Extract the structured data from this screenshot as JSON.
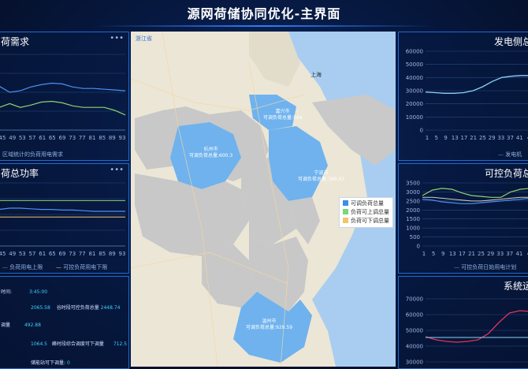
{
  "header": {
    "title": "源网荷储协同优化-主界面"
  },
  "panels": {
    "load_demand": {
      "title": "荷需求",
      "legend": "区域统计的负荷用电需求"
    },
    "load_power": {
      "title": "荷总功率",
      "legend_a": "负荷用电上限",
      "legend_b": "可控负荷用电下限"
    },
    "info": {
      "rows": [
        {
          "label": "时间",
          "value": "3:45:00"
        },
        {
          "label": "",
          "value": "2065.58",
          "label2": "谷时段可控负荷总量",
          "value2": "2448.74"
        },
        {
          "label": "调量",
          "value": "492.88"
        },
        {
          "label": "",
          "value": "1064.5",
          "label2": "峰时段综合调度可下调量",
          "value2": "712.5"
        },
        {
          "label": "储能站可下调量",
          "value": "0"
        }
      ]
    },
    "gen_side": {
      "title": "发电侧总",
      "legend": "发电机"
    },
    "ctrl_load": {
      "title": "可控负荷总",
      "legend": "可控负荷日始用电计划"
    },
    "sys_run": {
      "title": "系统运"
    }
  },
  "map": {
    "province": "浙江省",
    "shanghai": "上海",
    "cities": [
      {
        "name": "嘉兴市",
        "label": "可调负荷总量",
        "value": "564"
      },
      {
        "name": "杭州市",
        "label": "可调负荷总量",
        "value": "600.3"
      },
      {
        "name": "宁波市",
        "label": "可调负荷总量",
        "value": "389.63"
      },
      {
        "name": "温州市",
        "label": "可调负荷总量",
        "value": "929.59"
      }
    ],
    "legend": [
      "可调负荷总量",
      "负荷可上调总量",
      "负荷可下调总量"
    ],
    "legend_colors": [
      "#3b8fe8",
      "#7ad67a",
      "#f2c46b"
    ]
  },
  "axes": {
    "left_x_ticks": [
      "45",
      "49",
      "53",
      "57",
      "61",
      "65",
      "69",
      "73",
      "77",
      "81",
      "85",
      "89",
      "93"
    ],
    "right_x_ticks": [
      "1",
      "5",
      "9",
      "13",
      "17",
      "21",
      "25",
      "29",
      "33",
      "37",
      "41",
      "4"
    ],
    "gen_y": [
      "60000",
      "50000",
      "40000",
      "30000",
      "20000",
      "10000",
      "0"
    ],
    "ctrl_y": [
      "3500",
      "3000",
      "2500",
      "2000",
      "1500",
      "1000",
      "500",
      "0"
    ],
    "sys_y": [
      "70000",
      "60000",
      "50000",
      "40000",
      "30000"
    ]
  },
  "chart_data": [
    {
      "type": "line",
      "title": "荷需求",
      "x": [
        "45",
        "49",
        "53",
        "57",
        "61",
        "65",
        "69",
        "73",
        "77",
        "81",
        "85",
        "89",
        "93"
      ],
      "series": [
        {
          "values": [
            0.58,
            0.5,
            0.52,
            0.57,
            0.6,
            0.62,
            0.61,
            0.57,
            0.55,
            0.55,
            0.54,
            0.53,
            0.52
          ]
        },
        {
          "values": [
            0.3,
            0.35,
            0.3,
            0.33,
            0.37,
            0.38,
            0.36,
            0.32,
            0.3,
            0.3,
            0.3,
            0.26,
            0.2
          ]
        }
      ]
    },
    {
      "type": "line",
      "title": "荷总功率",
      "x": [
        "45",
        "49",
        "53",
        "57",
        "61",
        "65",
        "69",
        "73",
        "77",
        "81",
        "85",
        "89",
        "93"
      ],
      "series": [
        {
          "name": "负荷用电上限",
          "values": [
            0.72,
            0.72,
            0.72,
            0.72,
            0.72,
            0.72,
            0.72,
            0.72,
            0.72,
            0.72,
            0.72,
            0.72,
            0.72
          ]
        },
        {
          "name": "可控负荷用电下限",
          "values": [
            0.46,
            0.46,
            0.46,
            0.46,
            0.46,
            0.46,
            0.46,
            0.46,
            0.46,
            0.46,
            0.46,
            0.46,
            0.46
          ]
        },
        {
          "values": [
            0.58,
            0.6,
            0.6,
            0.59,
            0.58,
            0.58,
            0.57,
            0.57,
            0.56,
            0.55,
            0.55,
            0.55,
            0.55
          ]
        }
      ]
    },
    {
      "type": "line",
      "title": "发电侧总",
      "x": [
        "1",
        "5",
        "9",
        "13",
        "17",
        "21",
        "25",
        "29",
        "33",
        "37",
        "41",
        "4"
      ],
      "ylim": [
        0,
        60000
      ],
      "series": [
        {
          "name": "发电机",
          "values": [
            29000,
            28500,
            28000,
            28000,
            28500,
            30000,
            33000,
            37000,
            40000,
            41000,
            41500,
            41500
          ]
        }
      ]
    },
    {
      "type": "line",
      "title": "可控负荷总",
      "x": [
        "1",
        "5",
        "9",
        "13",
        "17",
        "21",
        "25",
        "29",
        "33",
        "37",
        "41",
        "4"
      ],
      "ylim": [
        0,
        3500
      ],
      "series": [
        {
          "values": [
            2800,
            3100,
            3200,
            3150,
            2950,
            2800,
            2750,
            2700,
            2700,
            3000,
            3150,
            3200
          ]
        },
        {
          "values": [
            2600,
            2550,
            2450,
            2400,
            2350,
            2350,
            2400,
            2450,
            2500,
            2550,
            2600,
            2650
          ]
        },
        {
          "name": "可控负荷日始用电计划",
          "values": [
            2700,
            2700,
            2650,
            2600,
            2550,
            2500,
            2500,
            2550,
            2600,
            2650,
            2700,
            2700
          ]
        }
      ]
    },
    {
      "type": "line",
      "title": "系统运",
      "ylim": [
        30000,
        70000
      ],
      "series": [
        {
          "values": [
            46000,
            44000,
            43000,
            42500,
            43000,
            44000,
            48000,
            55000,
            61000,
            62500,
            62000
          ]
        },
        {
          "values": [
            45500,
            45500,
            45500,
            45500,
            45500,
            45500,
            45500,
            45500,
            45500,
            45500,
            45500
          ]
        }
      ]
    }
  ]
}
